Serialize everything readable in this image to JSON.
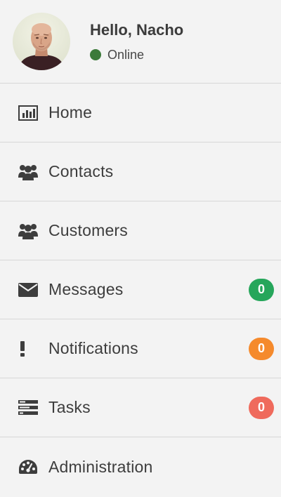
{
  "profile": {
    "greeting": "Hello, Nacho",
    "status": "Online",
    "status_color": "#3c7a3a",
    "avatar_icon": "user-photo"
  },
  "menu": {
    "items": [
      {
        "label": "Home",
        "icon": "bar-chart-icon"
      },
      {
        "label": "Contacts",
        "icon": "users-icon"
      },
      {
        "label": "Customers",
        "icon": "users-icon"
      },
      {
        "label": "Messages",
        "icon": "envelope-icon",
        "badge": "0",
        "badge_color": "#26a65b"
      },
      {
        "label": "Notifications",
        "icon": "exclamation-icon",
        "badge": "0",
        "badge_color": "#f58a2c"
      },
      {
        "label": "Tasks",
        "icon": "tasks-icon",
        "badge": "0",
        "badge_color": "#ef6a5c"
      },
      {
        "label": "Administration",
        "icon": "dashboard-icon"
      }
    ]
  },
  "colors": {
    "background": "#f3f3f3",
    "divider": "#d7d7d7",
    "text": "#3d3d3d",
    "icon": "#3d3d3d"
  }
}
